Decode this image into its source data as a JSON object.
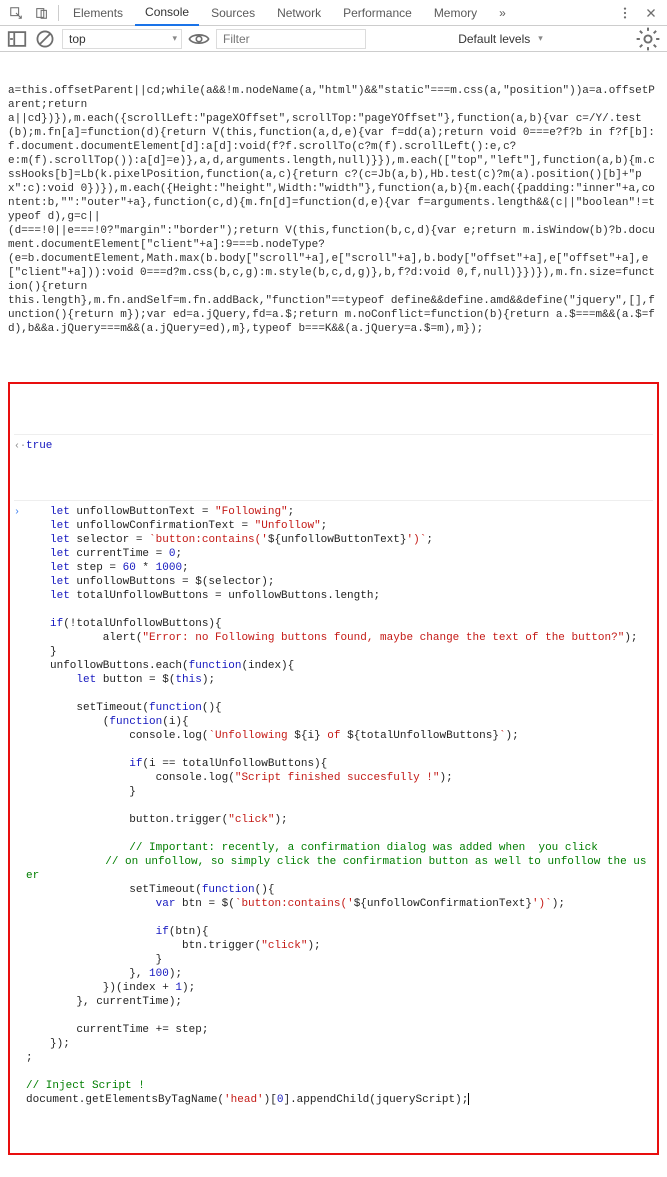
{
  "toolbar": {
    "tabs": [
      "Elements",
      "Console",
      "Sources",
      "Network",
      "Performance",
      "Memory"
    ],
    "active_tab": "Console",
    "more_glyph": "»"
  },
  "subbar": {
    "context": "top",
    "filter_placeholder": "Filter",
    "levels": "Default levels"
  },
  "minified_output": "a=this.offsetParent||cd;while(a&&!m.nodeName(a,\"html\")&&\"static\"===m.css(a,\"position\"))a=a.offsetParent;return\na||cd})}),m.each({scrollLeft:\"pageXOffset\",scrollTop:\"pageYOffset\"},function(a,b){var c=/Y/.test(b);m.fn[a]=function(d){return V(this,function(a,d,e){var f=dd(a);return void 0===e?f?b in f?f[b]:f.document.documentElement[d]:a[d]:void(f?f.scrollTo(c?m(f).scrollLeft():e,c?\ne:m(f).scrollTop()):a[d]=e)},a,d,arguments.length,null)}}),m.each([\"top\",\"left\"],function(a,b){m.cssHooks[b]=Lb(k.pixelPosition,function(a,c){return c?(c=Jb(a,b),Hb.test(c)?m(a).position()[b]+\"px\":c):void 0})}),m.each({Height:\"height\",Width:\"width\"},function(a,b){m.each({padding:\"inner\"+a,content:b,\"\":\"outer\"+a},function(c,d){m.fn[d]=function(d,e){var f=arguments.length&&(c||\"boolean\"!=typeof d),g=c||\n(d===!0||e===!0?\"margin\":\"border\");return V(this,function(b,c,d){var e;return m.isWindow(b)?b.document.documentElement[\"client\"+a]:9===b.nodeType?\n(e=b.documentElement,Math.max(b.body[\"scroll\"+a],e[\"scroll\"+a],b.body[\"offset\"+a],e[\"offset\"+a],e[\"client\"+a])):void 0===d?m.css(b,c,g):m.style(b,c,d,g)},b,f?d:void 0,f,null)}})}),m.fn.size=function(){return\nthis.length},m.fn.andSelf=m.fn.addBack,\"function\"==typeof define&&define.amd&&define(\"jquery\",[],function(){return m});var ed=a.jQuery,fd=a.$;return m.noConflict=function(b){return a.$===m&&(a.$=fd),b&&a.jQuery===m&&(a.jQuery=ed),m},typeof b===K&&(a.jQuery=a.$=m),m});",
  "result_true": "true",
  "code": {
    "l1a": "let",
    "l1b": " unfollowButtonText = ",
    "l1c": "\"Following\"",
    "l1d": ";",
    "l2a": "let",
    "l2b": " unfollowConfirmationText = ",
    "l2c": "\"Unfollow\"",
    "l2d": ";",
    "l3a": "let",
    "l3b": " selector = ",
    "l3c": "`button:contains('",
    "l3d": "${",
    "l3e": "unfollowButtonText",
    "l3f": "}",
    "l3g": "')`",
    "l3h": ";",
    "l4a": "let",
    "l4b": " currentTime = ",
    "l4c": "0",
    "l4d": ";",
    "l5a": "let",
    "l5b": " step = ",
    "l5c": "60",
    "l5d": " * ",
    "l5e": "1000",
    "l5f": ";",
    "l6a": "let",
    "l6b": " unfollowButtons = $(selector);",
    "l7a": "let",
    "l7b": " totalUnfollowButtons = unfollowButtons.length;",
    "l9a": "if",
    "l9b": "(!totalUnfollowButtons){",
    "l10a": "        alert(",
    "l10b": "\"Error: no Following buttons found, maybe change the text of the button?\"",
    "l10c": ");",
    "l11": "}",
    "l12a": "unfollowButtons.each(",
    "l12b": "function",
    "l12c": "(index){",
    "l13a": "    ",
    "l13b": "let",
    "l13c": " button = $(",
    "l13d": "this",
    "l13e": ");",
    "l15a": "    setTimeout(",
    "l15b": "function",
    "l15c": "(){",
    "l16a": "        (",
    "l16b": "function",
    "l16c": "(i){",
    "l17a": "            console.log(",
    "l17b": "`Unfollowing ",
    "l17c": "${",
    "l17d": "i",
    "l17e": "}",
    "l17f": " of ",
    "l17g": "${",
    "l17h": "totalUnfollowButtons",
    "l17i": "}",
    "l17j": "`",
    "l17k": ");",
    "l19a": "            ",
    "l19b": "if",
    "l19c": "(i == totalUnfollowButtons){",
    "l20a": "                console.log(",
    "l20b": "\"Script finished succesfully !\"",
    "l20c": ");",
    "l21": "            }",
    "l23a": "            button.trigger(",
    "l23b": "\"click\"",
    "l23c": ");",
    "l25": "            // Important: recently, a confirmation dialog was added when  you click",
    "l26": "            // on unfollow, so simply click the confirmation button as well to unfollow the user",
    "l27a": "            setTimeout(",
    "l27b": "function",
    "l27c": "(){",
    "l28a": "                ",
    "l28b": "var",
    "l28c": " btn = $(",
    "l28d": "`button:contains('",
    "l28e": "${",
    "l28f": "unfollowConfirmationText",
    "l28g": "}",
    "l28h": "')`",
    "l28i": ");",
    "l30a": "                ",
    "l30b": "if",
    "l30c": "(btn){",
    "l31a": "                    btn.trigger(",
    "l31b": "\"click\"",
    "l31c": ");",
    "l32": "                }",
    "l33a": "            }, ",
    "l33b": "100",
    "l33c": ");",
    "l34a": "        })(index + ",
    "l34b": "1",
    "l34c": ");",
    "l35": "    }, currentTime);",
    "l37": "    currentTime += step;",
    "l38": "});",
    "l39": ";",
    "l41": "// Inject Script !",
    "l42a": "document.getElementsByTagName(",
    "l42b": "'head'",
    "l42c": ")[",
    "l42d": "0",
    "l42e": "].appendChild(jqueryScript);"
  }
}
